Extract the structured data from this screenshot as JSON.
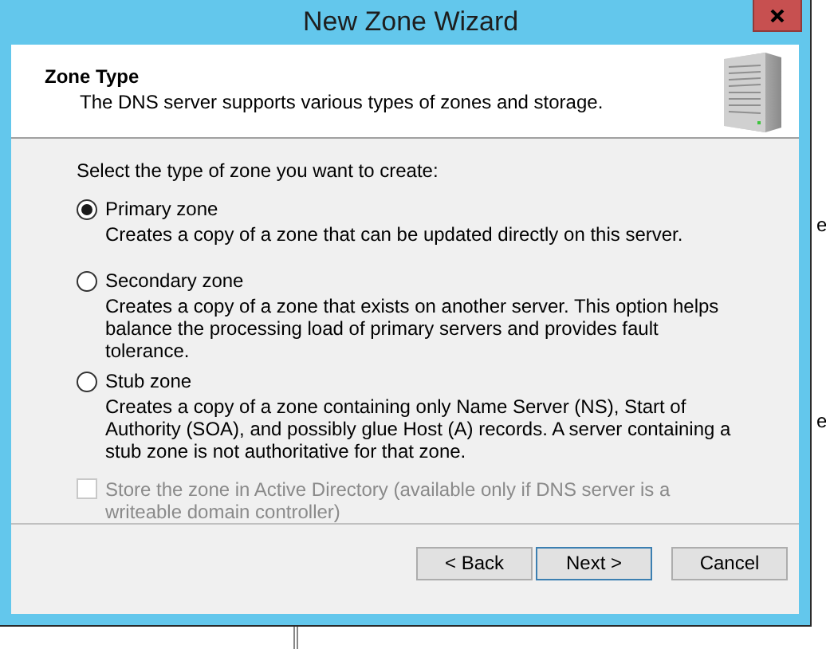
{
  "window": {
    "title": "New Zone Wizard"
  },
  "header": {
    "title": "Zone Type",
    "subtitle": "The DNS server supports various types of zones and storage."
  },
  "prompt": "Select the type of zone you want to create:",
  "options": [
    {
      "label": "Primary zone",
      "description": "Creates a copy of a zone that can be updated directly on this server.",
      "selected": true
    },
    {
      "label": "Secondary zone",
      "description": "Creates a copy of a zone that exists on another server. This option helps balance the processing load of primary servers and provides fault tolerance.",
      "selected": false
    },
    {
      "label": "Stub zone",
      "description": "Creates a copy of a zone containing only Name Server (NS), Start of Authority (SOA), and possibly glue Host (A) records. A server containing a stub zone is not authoritative for that zone.",
      "selected": false
    }
  ],
  "store_option": {
    "label": "Store the zone in Active Directory (available only if DNS server is a writeable domain controller)",
    "checked": false,
    "disabled": true
  },
  "buttons": [
    {
      "label": "< Back",
      "default": false
    },
    {
      "label": "Next >",
      "default": true
    },
    {
      "label": "Cancel",
      "default": false
    }
  ],
  "background_fragments": [
    "e",
    "e"
  ]
}
